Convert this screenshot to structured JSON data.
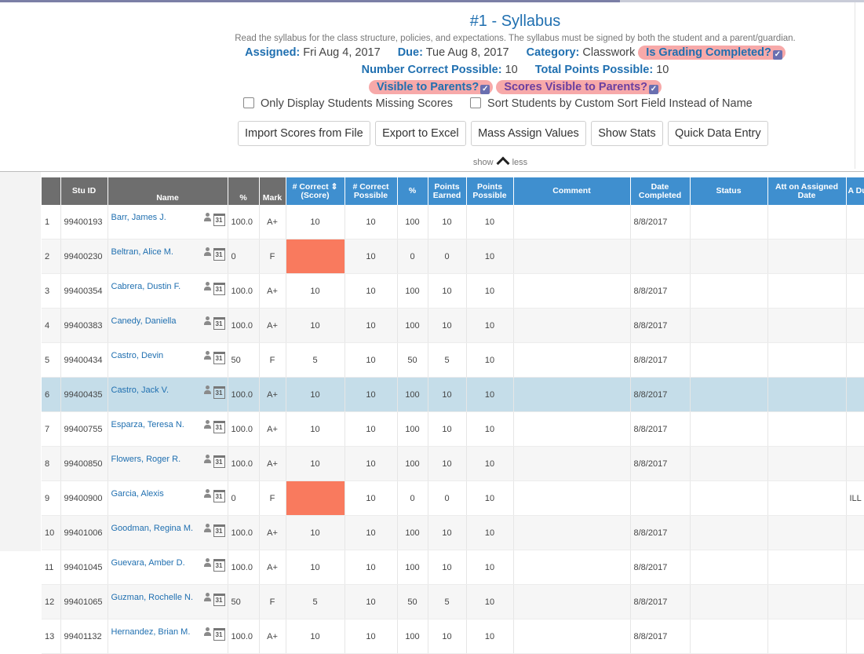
{
  "assignment": {
    "title": "#1 - Syllabus",
    "description": "Read the syllabus for the class structure, policies, and expectations. The syllabus must be signed by both the student and a parent/guardian.",
    "assigned_label": "Assigned:",
    "assigned_value": "Fri Aug 4, 2017",
    "due_label": "Due:",
    "due_value": "Tue Aug 8, 2017",
    "category_label": "Category:",
    "category_value": "Classwork",
    "grading_completed_label": "Is Grading Completed?",
    "number_correct_label": "Number Correct Possible:",
    "number_correct_value": "10",
    "total_points_label": "Total Points Possible:",
    "total_points_value": "10",
    "visible_parents_label": "Visible to Parents?",
    "scores_visible_label": "Scores Visible to Parents?",
    "check_glyph": "✓"
  },
  "options": {
    "missing_only": "Only Display Students Missing Scores",
    "custom_sort": "Sort Students by Custom Sort Field Instead of Name"
  },
  "toolbar": {
    "import": "Import Scores from File",
    "export": "Export to Excel",
    "mass_assign": "Mass Assign Values",
    "stats": "Show Stats",
    "quick_entry": "Quick Data Entry"
  },
  "toggle": {
    "show": "show",
    "less": "less"
  },
  "calendar_glyph": "31",
  "colors": {
    "header_dark": "#6e6e6e",
    "header_blue": "#3f8fcf",
    "link": "#1f6fb0",
    "missing": "#f97a5e",
    "selected_row": "#c5dde9",
    "pill": "#f7a9a9"
  },
  "table": {
    "headers": {
      "stu_id": "Stu ID",
      "name": "Name",
      "pct": "%",
      "mark": "Mark",
      "correct_score": "# Correct ⇕ (Score)",
      "correct_possible": "# Correct Possible",
      "pct2": "%",
      "points_earned": "Points Earned",
      "points_possible": "Points Possible",
      "comment": "Comment",
      "date_completed": "Date Completed",
      "status": "Status",
      "att_assigned": "Att on Assigned Date",
      "extra": "A Du"
    },
    "rows": [
      {
        "n": "1",
        "id": "99400193",
        "name": "Barr, James J.",
        "pct": "100.0",
        "mark": "A+",
        "score": "10",
        "poss": "10",
        "pct2": "100",
        "earned": "10",
        "ppos": "10",
        "date": "8/8/2017",
        "extra": ""
      },
      {
        "n": "2",
        "id": "99400230",
        "name": "Beltran, Alice M.",
        "pct": "0",
        "mark": "F",
        "score": "",
        "poss": "10",
        "pct2": "0",
        "earned": "0",
        "ppos": "10",
        "date": "",
        "extra": ""
      },
      {
        "n": "3",
        "id": "99400354",
        "name": "Cabrera, Dustin F.",
        "pct": "100.0",
        "mark": "A+",
        "score": "10",
        "poss": "10",
        "pct2": "100",
        "earned": "10",
        "ppos": "10",
        "date": "8/8/2017",
        "extra": ""
      },
      {
        "n": "4",
        "id": "99400383",
        "name": "Canedy, Daniella",
        "pct": "100.0",
        "mark": "A+",
        "score": "10",
        "poss": "10",
        "pct2": "100",
        "earned": "10",
        "ppos": "10",
        "date": "8/8/2017",
        "extra": ""
      },
      {
        "n": "5",
        "id": "99400434",
        "name": "Castro, Devin",
        "pct": "50",
        "mark": "F",
        "score": "5",
        "poss": "10",
        "pct2": "50",
        "earned": "5",
        "ppos": "10",
        "date": "8/8/2017",
        "extra": ""
      },
      {
        "n": "6",
        "id": "99400435",
        "name": "Castro, Jack V.",
        "pct": "100.0",
        "mark": "A+",
        "score": "10",
        "poss": "10",
        "pct2": "100",
        "earned": "10",
        "ppos": "10",
        "date": "8/8/2017",
        "extra": ""
      },
      {
        "n": "7",
        "id": "99400755",
        "name": "Esparza, Teresa N.",
        "pct": "100.0",
        "mark": "A+",
        "score": "10",
        "poss": "10",
        "pct2": "100",
        "earned": "10",
        "ppos": "10",
        "date": "8/8/2017",
        "extra": ""
      },
      {
        "n": "8",
        "id": "99400850",
        "name": "Flowers, Roger R.",
        "pct": "100.0",
        "mark": "A+",
        "score": "10",
        "poss": "10",
        "pct2": "100",
        "earned": "10",
        "ppos": "10",
        "date": "8/8/2017",
        "extra": ""
      },
      {
        "n": "9",
        "id": "99400900",
        "name": "Garcia, Alexis",
        "pct": "0",
        "mark": "F",
        "score": "",
        "poss": "10",
        "pct2": "0",
        "earned": "0",
        "ppos": "10",
        "date": "",
        "extra": "ILL"
      },
      {
        "n": "10",
        "id": "99401006",
        "name": "Goodman, Regina M.",
        "pct": "100.0",
        "mark": "A+",
        "score": "10",
        "poss": "10",
        "pct2": "100",
        "earned": "10",
        "ppos": "10",
        "date": "8/8/2017",
        "extra": ""
      },
      {
        "n": "11",
        "id": "99401045",
        "name": "Guevara, Amber D.",
        "pct": "100.0",
        "mark": "A+",
        "score": "10",
        "poss": "10",
        "pct2": "100",
        "earned": "10",
        "ppos": "10",
        "date": "8/8/2017",
        "extra": ""
      },
      {
        "n": "12",
        "id": "99401065",
        "name": "Guzman, Rochelle N.",
        "pct": "50",
        "mark": "F",
        "score": "5",
        "poss": "10",
        "pct2": "50",
        "earned": "5",
        "ppos": "10",
        "date": "8/8/2017",
        "extra": ""
      },
      {
        "n": "13",
        "id": "99401132",
        "name": "Hernandez, Brian M.",
        "pct": "100.0",
        "mark": "A+",
        "score": "10",
        "poss": "10",
        "pct2": "100",
        "earned": "10",
        "ppos": "10",
        "date": "8/8/2017",
        "extra": ""
      }
    ]
  }
}
